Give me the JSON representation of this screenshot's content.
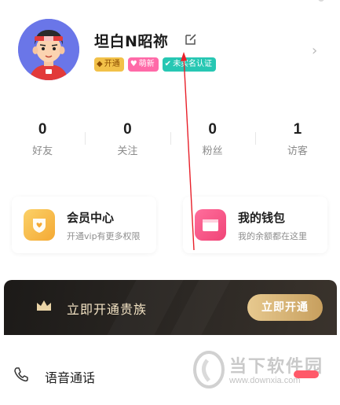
{
  "profile": {
    "username": "坦白N昭祢",
    "avatar_icon": "cartoon-boy-avatar",
    "edit_icon": "edit-icon",
    "badges": [
      {
        "label": "开通",
        "icon": "vip-diamond-icon",
        "color": "#f2c149"
      },
      {
        "label": "萌新",
        "icon": "heart-icon",
        "color": "#ff6aa8"
      },
      {
        "label": "未实名认证",
        "icon": "verified-v-icon",
        "color": "#27c7b3"
      }
    ],
    "chevron": "›"
  },
  "stats": [
    {
      "value": "0",
      "label": "好友"
    },
    {
      "value": "0",
      "label": "关注"
    },
    {
      "value": "0",
      "label": "粉丝"
    },
    {
      "value": "1",
      "label": "访客"
    }
  ],
  "cards": {
    "member": {
      "title": "会员中心",
      "subtitle": "开通vip有更多权限",
      "icon": "heart-shield-icon"
    },
    "wallet": {
      "title": "我的钱包",
      "subtitle": "我的余额都在这里",
      "icon": "wallet-icon"
    }
  },
  "noble": {
    "text": "立即开通贵族",
    "button": "立即开通",
    "icon": "crown-icon"
  },
  "menu": {
    "voice_call": "语音通话",
    "icon": "phone-icon"
  },
  "watermark": {
    "name": "当下软件园",
    "url": "www.downxia.com"
  },
  "colors": {
    "accent_gold": "#c79f5e",
    "annotation_red": "#e8202a",
    "stat_text": "#1f1f1f"
  }
}
